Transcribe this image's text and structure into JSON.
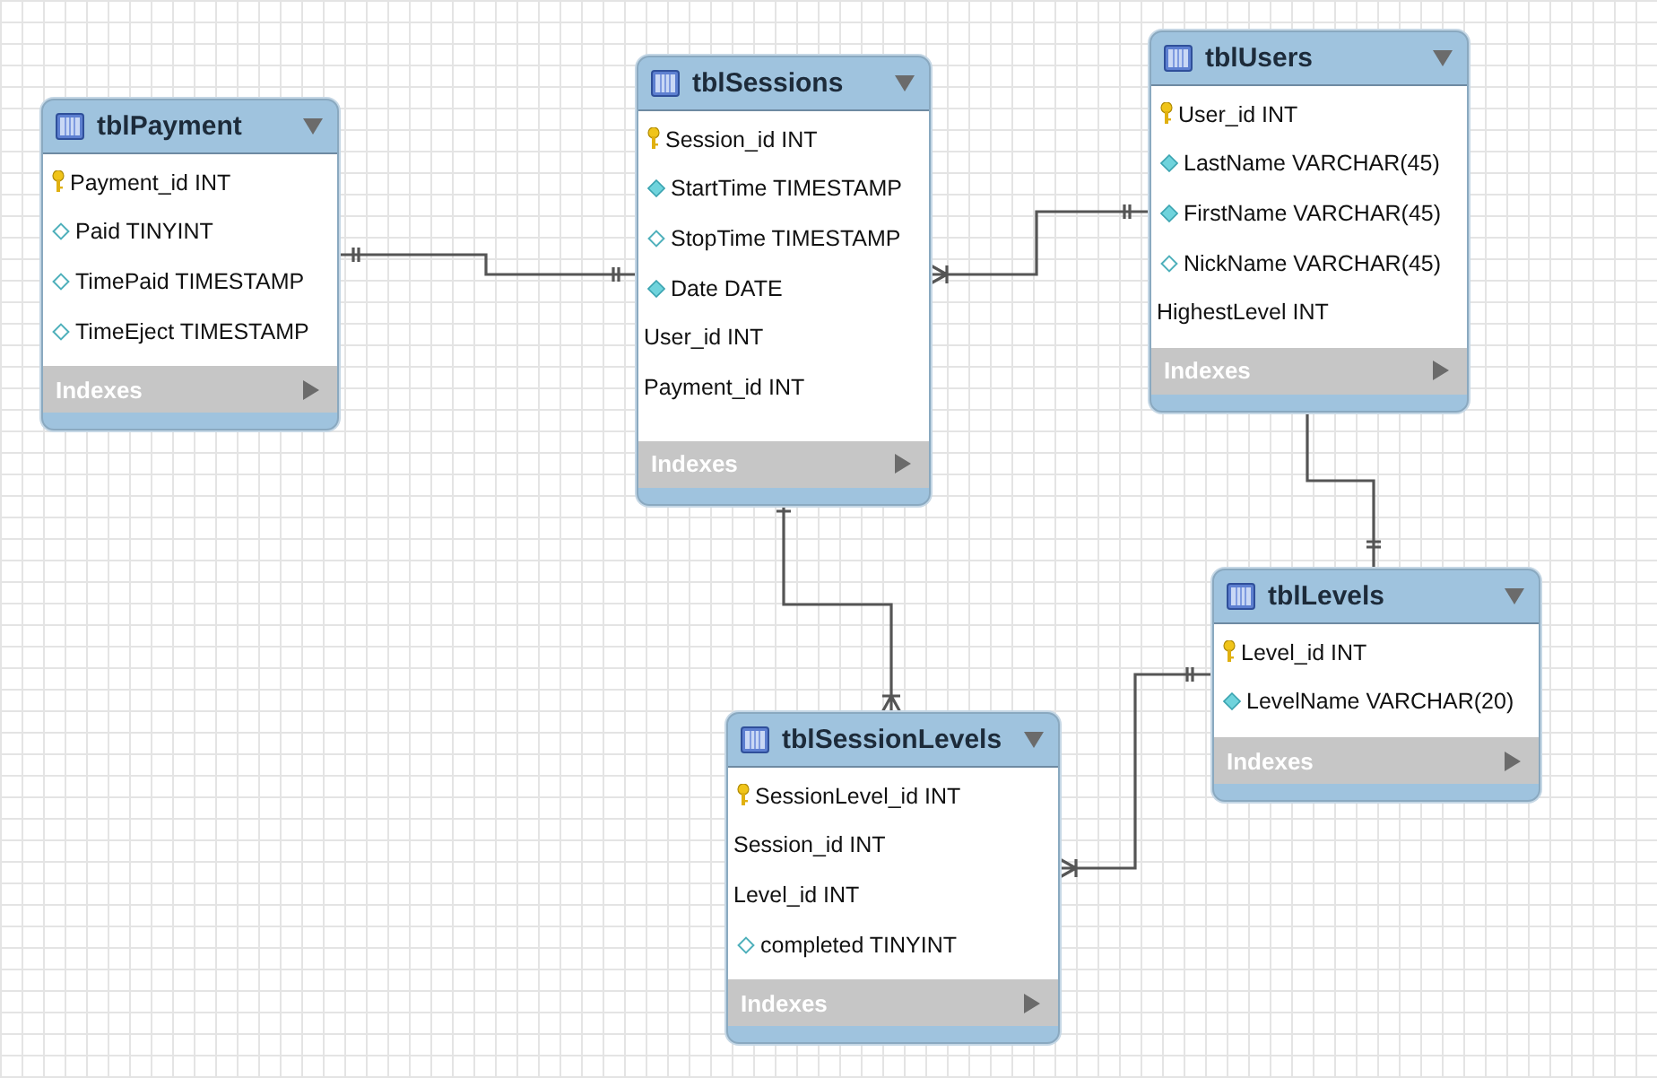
{
  "tables": [
    {
      "title": "tblPayment",
      "columns": [
        {
          "text": "Payment_id INT",
          "kind": "primary"
        },
        {
          "text": "Paid TINYINT",
          "kind": "nullable"
        },
        {
          "text": "TimePaid TIMESTAMP",
          "kind": "nullable"
        },
        {
          "text": "TimeEject TIMESTAMP",
          "kind": "nullable"
        }
      ],
      "indexes": "Indexes"
    },
    {
      "title": "tblSessions",
      "columns": [
        {
          "text": "Session_id INT",
          "kind": "primary"
        },
        {
          "text": "StartTime TIMESTAMP",
          "kind": "required"
        },
        {
          "text": "StopTime TIMESTAMP",
          "kind": "nullable"
        },
        {
          "text": "Date DATE",
          "kind": "required"
        },
        {
          "text": "User_id INT",
          "kind": "foreign"
        },
        {
          "text": "Payment_id INT",
          "kind": "foreign"
        }
      ],
      "indexes": "Indexes"
    },
    {
      "title": "tblUsers",
      "columns": [
        {
          "text": "User_id INT",
          "kind": "primary"
        },
        {
          "text": "LastName VARCHAR(45)",
          "kind": "required"
        },
        {
          "text": "FirstName VARCHAR(45)",
          "kind": "required"
        },
        {
          "text": "NickName VARCHAR(45)",
          "kind": "nullable"
        },
        {
          "text": "HighestLevel INT",
          "kind": "foreign"
        }
      ],
      "indexes": "Indexes"
    },
    {
      "title": "tblLevels",
      "columns": [
        {
          "text": "Level_id INT",
          "kind": "primary"
        },
        {
          "text": "LevelName VARCHAR(20)",
          "kind": "required"
        }
      ],
      "indexes": "Indexes"
    },
    {
      "title": "tblSessionLevels",
      "columns": [
        {
          "text": "SessionLevel_id INT",
          "kind": "primary"
        },
        {
          "text": "Session_id INT",
          "kind": "foreign"
        },
        {
          "text": "Level_id INT",
          "kind": "foreign"
        },
        {
          "text": "completed TINYINT",
          "kind": "nullable"
        }
      ],
      "indexes": "Indexes"
    }
  ]
}
